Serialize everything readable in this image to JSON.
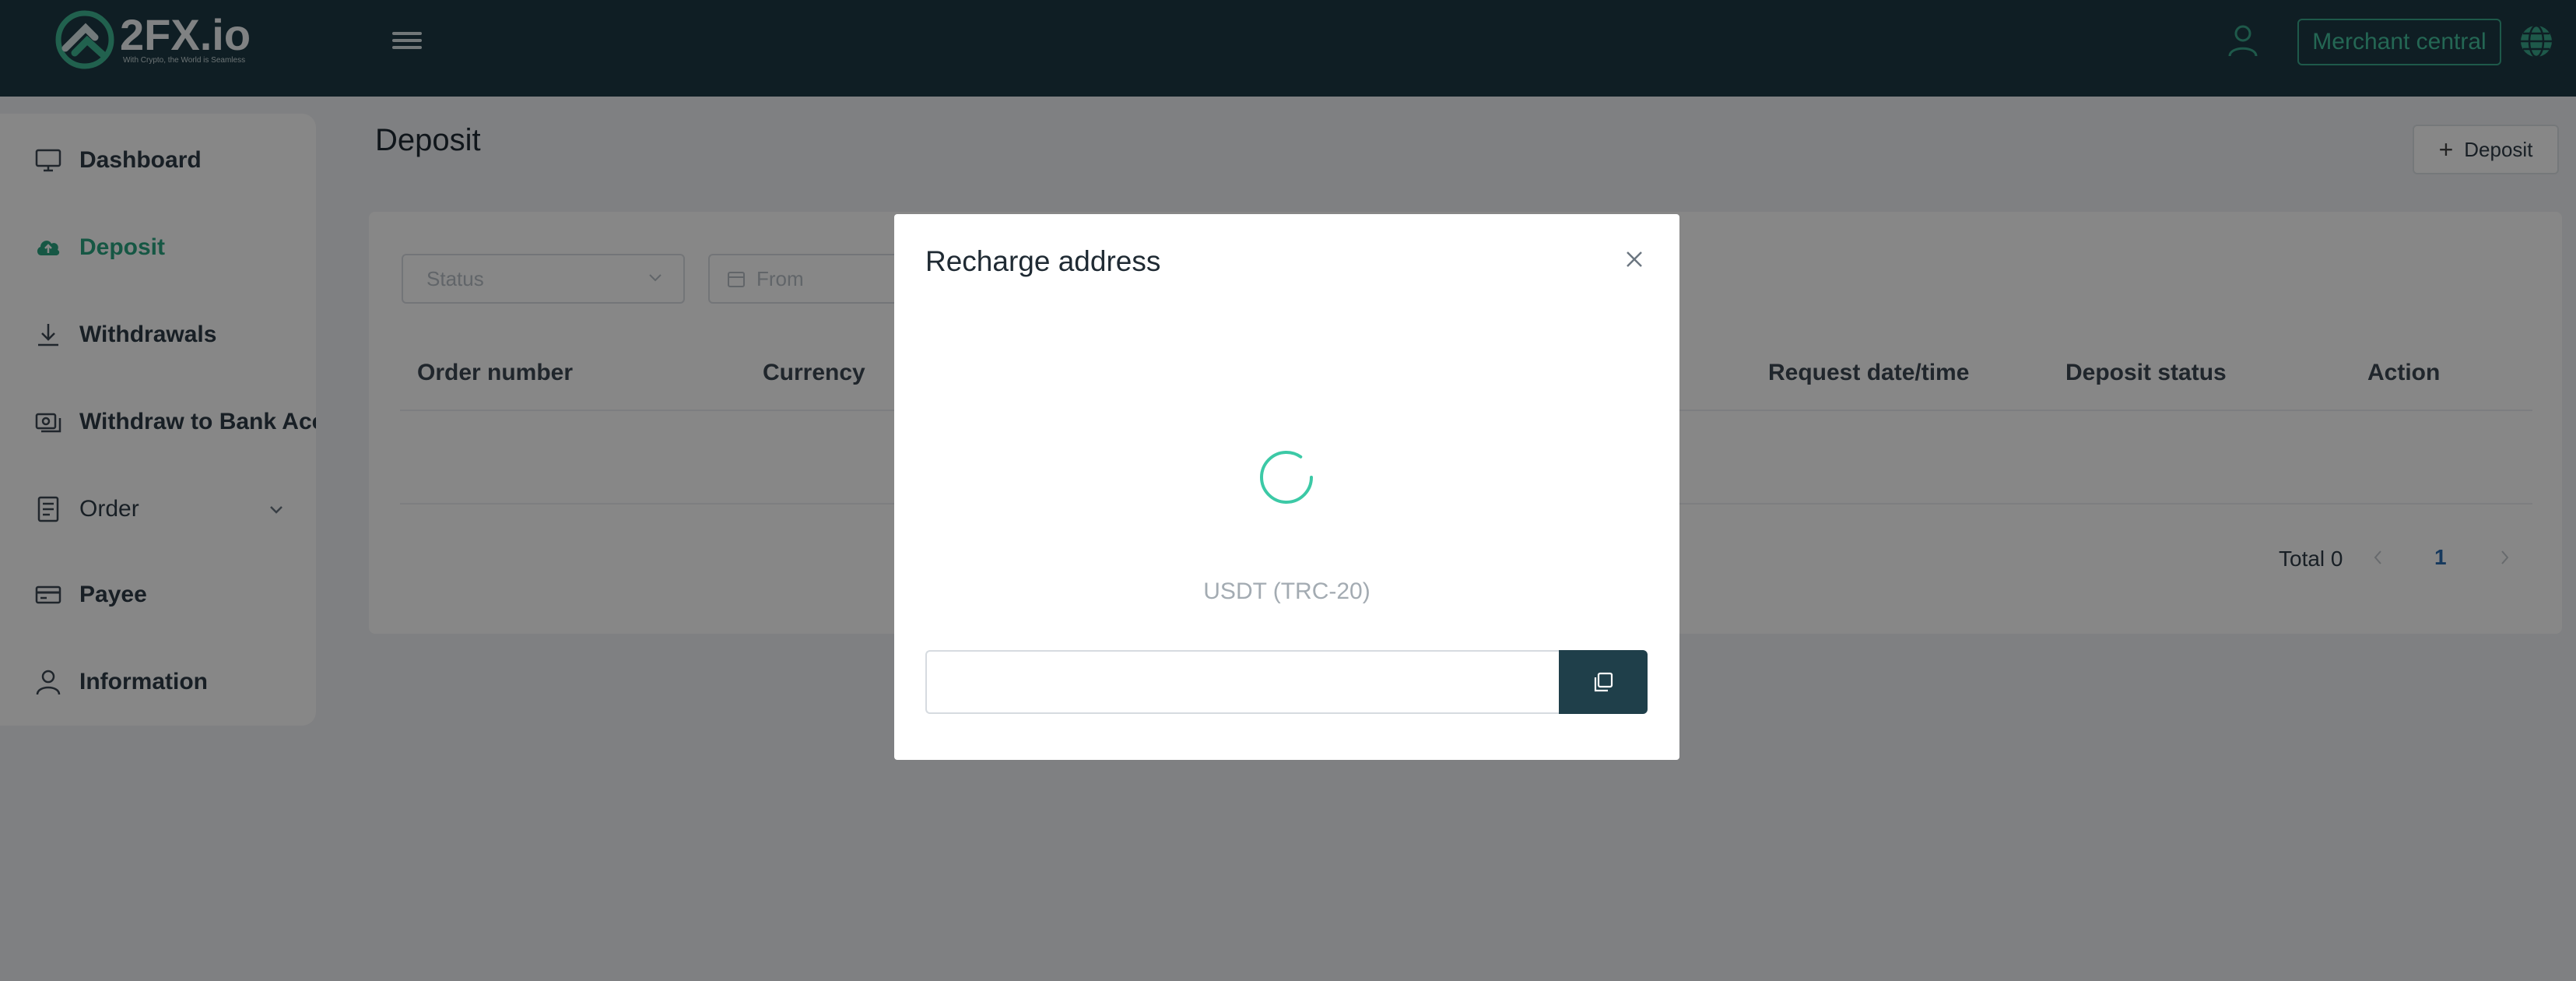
{
  "header": {
    "logo_name": "2FX.io",
    "logo_tagline": "With Crypto, the World is Seamless",
    "merchant_button": "Merchant central",
    "icons": {
      "menu": "hamburger-icon",
      "user": "user-icon",
      "language": "globe-icon"
    }
  },
  "sidebar": {
    "items": [
      {
        "label": "Dashboard",
        "icon": "monitor-icon",
        "active": false
      },
      {
        "label": "Deposit",
        "icon": "cloud-upload-icon",
        "active": true
      },
      {
        "label": "Withdrawals",
        "icon": "download-icon",
        "active": false
      },
      {
        "label": "Withdraw to Bank Acco",
        "icon": "bank-transfer-icon",
        "active": false
      },
      {
        "label": "Order",
        "icon": "document-icon",
        "active": false
      },
      {
        "label": "Payee",
        "icon": "card-icon",
        "active": false
      },
      {
        "label": "Information",
        "icon": "user-icon",
        "active": false
      }
    ]
  },
  "main": {
    "title": "Deposit",
    "deposit_button": "Deposit",
    "filters": {
      "status_placeholder": "Status",
      "from_placeholder": "From"
    },
    "table": {
      "columns": [
        "Order number",
        "Currency",
        "Request date/time",
        "Deposit status",
        "Action"
      ],
      "rows": []
    },
    "pagination": {
      "total_label": "Total 0",
      "current_page": "1"
    }
  },
  "modal": {
    "title": "Recharge address",
    "network": "USDT (TRC-20)",
    "address_value": "",
    "colors": {
      "spinner": "#3cc9a6",
      "copy_button": "#1f3f4a"
    }
  },
  "colors": {
    "header_bg": "#1e3a44",
    "accent": "#2ba580",
    "page_bg": "#f0f2f5"
  }
}
